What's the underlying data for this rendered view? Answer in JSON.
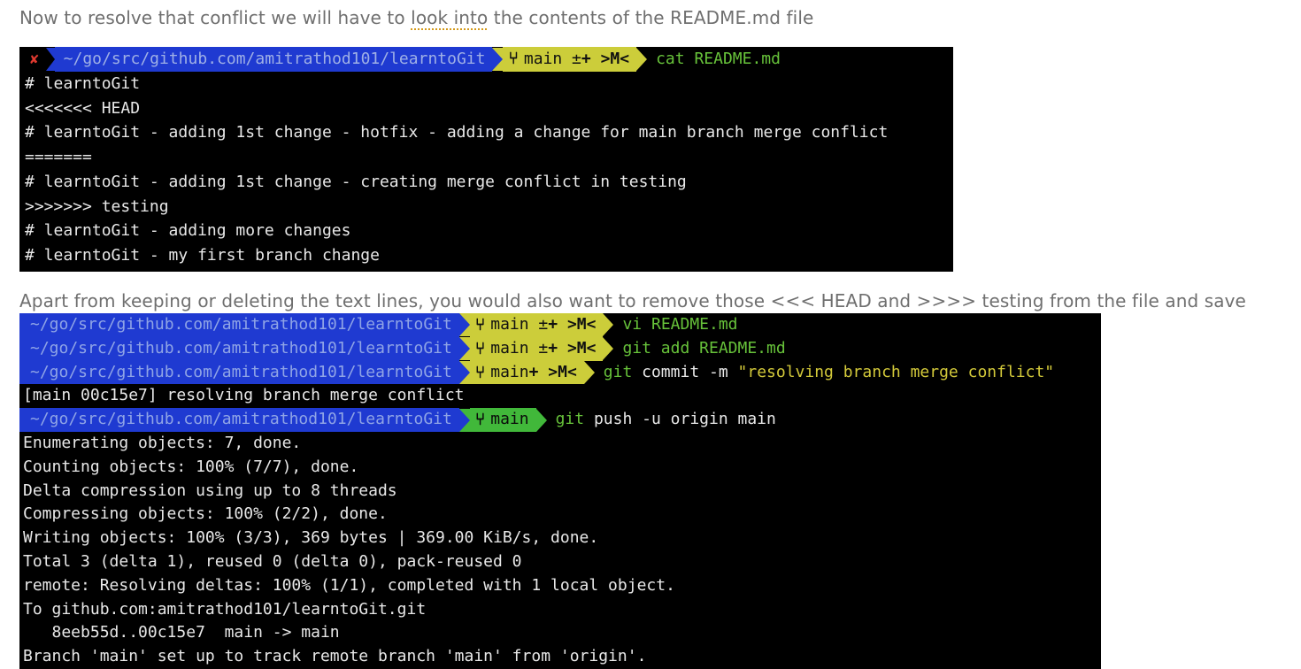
{
  "prose": {
    "line1_before": "Now to resolve that conflict we will have to ",
    "line1_spell": "look into",
    "line1_after": " the contents of the README.md file",
    "line2": "Apart from keeping or deleting the text lines, you would also want to remove those <<< HEAD and >>>> testing from the file and save"
  },
  "terminal1": {
    "prompt": {
      "status_icon": "✘",
      "path": "~/go/src/github.com/amitrathod101/learntoGit",
      "branch_icon": "",
      "branch": "main ±",
      "branch_flags": "+ >M<",
      "command": "cat README.md"
    },
    "output": [
      "# learntoGit",
      "<<<<<<< HEAD",
      "# learntoGit - adding 1st change - hotfix - adding a change for main branch merge conflict",
      "=======",
      "# learntoGit - adding 1st change - creating merge conflict in testing",
      ">>>>>>> testing",
      "# learntoGit - adding more changes",
      "# learntoGit - my first branch change"
    ]
  },
  "terminal2": {
    "prompts": [
      {
        "path": "~/go/src/github.com/amitrathod101/learntoGit",
        "branch": "main ±",
        "flags": "+ >M<",
        "cmd_head": "vi",
        "cmd_rest": " README.md"
      },
      {
        "path": "~/go/src/github.com/amitrathod101/learntoGit",
        "branch": "main ±",
        "flags": "+ >M<",
        "cmd_head": "git",
        "cmd_rest": " add README.md"
      },
      {
        "path": "~/go/src/github.com/amitrathod101/learntoGit",
        "branch": "main",
        "flags": "+ >M<",
        "cmd_head": "git",
        "cmd_rest": " commit -m ",
        "cmd_string": "\"resolving branch merge conflict\""
      }
    ],
    "commit_result": "[main 00c15e7] resolving branch merge conflict",
    "push_prompt": {
      "path": "~/go/src/github.com/amitrathod101/learntoGit",
      "branch": "main",
      "cmd_head": "git",
      "cmd_rest": " push -u origin main"
    },
    "output": [
      "Enumerating objects: 7, done.",
      "Counting objects: 100% (7/7), done.",
      "Delta compression using up to 8 threads",
      "Compressing objects: 100% (2/2), done.",
      "Writing objects: 100% (3/3), 369 bytes | 369.00 KiB/s, done.",
      "Total 3 (delta 1), reused 0 (delta 0), pack-reused 0",
      "remote: Resolving deltas: 100% (1/1), completed with 1 local object.",
      "To github.com:amitrathod101/learntoGit.git",
      "   8eeb55d..00c15e7  main -> main",
      "Branch 'main' set up to track remote branch 'main' from 'origin'."
    ]
  },
  "colors": {
    "path_bg": "#1f3ad1",
    "branch_dirty_bg": "#cccd3a",
    "branch_clean_bg": "#41b83a",
    "status_error": "#e0392f",
    "command_green": "#67c23a",
    "string_yellow": "#d3c93a"
  }
}
